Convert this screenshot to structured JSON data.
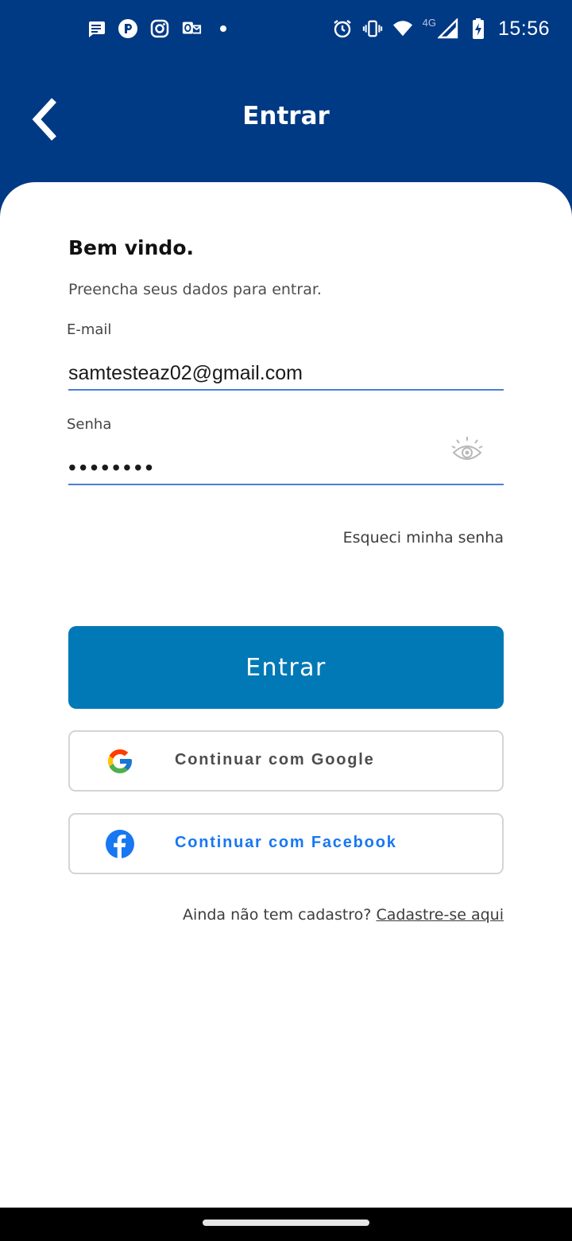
{
  "status_bar": {
    "time": "15:56",
    "network": "4G",
    "left_icons": [
      "message-icon",
      "app-badge-icon",
      "instagram-icon",
      "outlook-icon",
      "dot-icon"
    ],
    "right_icons": [
      "alarm-icon",
      "vibrate-icon",
      "wifi-icon",
      "signal-icon",
      "battery-charging-icon"
    ]
  },
  "header": {
    "title": "Entrar",
    "back_icon": "chevron-left-icon"
  },
  "colors": {
    "header_bg": "#003984",
    "primary_button": "#0179b6",
    "input_underline": "#4a7fd8",
    "facebook_blue": "#1877f2",
    "google_text": "#4d4d4d"
  },
  "form": {
    "welcome_title": "Bem vindo.",
    "welcome_subtitle": "Preencha seus dados para entrar.",
    "email_label": "E-mail",
    "email_value": "samtesteaz02@gmail.com",
    "password_label": "Senha",
    "password_value": "••••••••",
    "password_toggle_icon": "eye-icon",
    "forgot_password": "Esqueci minha senha",
    "login_button": "Entrar"
  },
  "social": {
    "google_label": "Continuar com Google",
    "google_icon": "google-icon",
    "facebook_label": "Continuar com Facebook",
    "facebook_icon": "facebook-icon"
  },
  "signup": {
    "prompt": "Ainda não tem cadastro?",
    "link": "Cadastre-se aqui"
  }
}
